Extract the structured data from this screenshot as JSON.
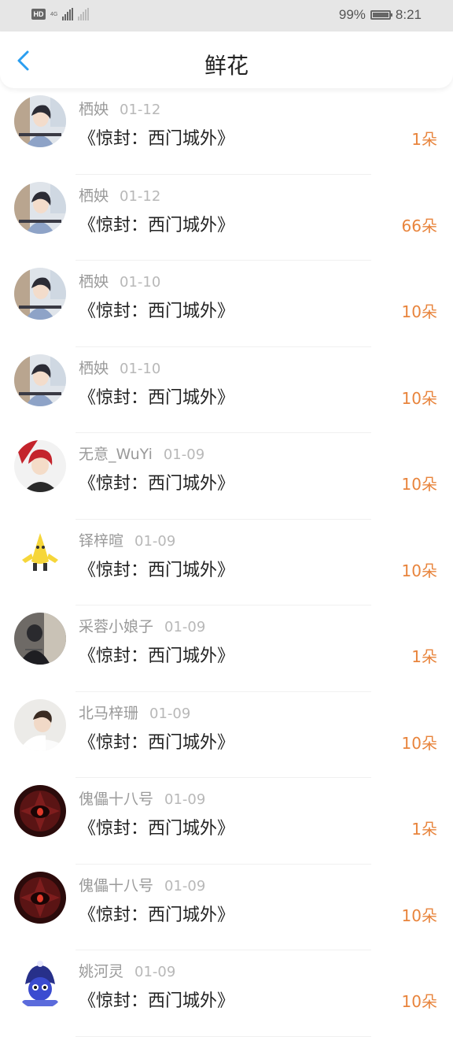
{
  "status_bar": {
    "network": "4G",
    "battery": "99%",
    "battery_level": 0.99,
    "time": "8:21",
    "icons": [
      "hd-icon",
      "signal-icon",
      "no-signal-icon",
      "battery-icon"
    ]
  },
  "header": {
    "title": "鲜花",
    "back_icon": "chevron-left-icon",
    "accent": "#2a9ef0"
  },
  "colors": {
    "count": "#e8843c",
    "name": "#9a9a9a",
    "text": "#222222"
  },
  "rows": [
    {
      "user": "栖姎",
      "date": "01-12",
      "book": "《惊封：西门城外》",
      "count": "1朵",
      "avatar": "anime-boy-avatar"
    },
    {
      "user": "栖姎",
      "date": "01-12",
      "book": "《惊封：西门城外》",
      "count": "66朵",
      "avatar": "anime-boy-avatar"
    },
    {
      "user": "栖姎",
      "date": "01-10",
      "book": "《惊封：西门城外》",
      "count": "10朵",
      "avatar": "anime-boy-avatar"
    },
    {
      "user": "栖姎",
      "date": "01-10",
      "book": "《惊封：西门城外》",
      "count": "10朵",
      "avatar": "anime-boy-avatar"
    },
    {
      "user": "无意_WuYi",
      "date": "01-09",
      "book": "《惊封：西门城外》",
      "count": "10朵",
      "avatar": "red-hair-avatar"
    },
    {
      "user": "铎梓暄",
      "date": "01-09",
      "book": "《惊封：西门城外》",
      "count": "10朵",
      "avatar": "banana-avatar"
    },
    {
      "user": "采蓉小娘子",
      "date": "01-09",
      "book": "《惊封：西门城外》",
      "count": "1朵",
      "avatar": "dark-photo-avatar"
    },
    {
      "user": "北马梓珊",
      "date": "01-09",
      "book": "《惊封：西门城外》",
      "count": "10朵",
      "avatar": "boy-photo-avatar"
    },
    {
      "user": "傀儡十八号",
      "date": "01-09",
      "book": "《惊封：西门城外》",
      "count": "1朵",
      "avatar": "red-eye-avatar"
    },
    {
      "user": "傀儡十八号",
      "date": "01-09",
      "book": "《惊封：西门城外》",
      "count": "10朵",
      "avatar": "red-eye-avatar"
    },
    {
      "user": "姚河灵",
      "date": "01-09",
      "book": "《惊封：西门城外》",
      "count": "10朵",
      "avatar": "blue-mascot-avatar"
    }
  ]
}
